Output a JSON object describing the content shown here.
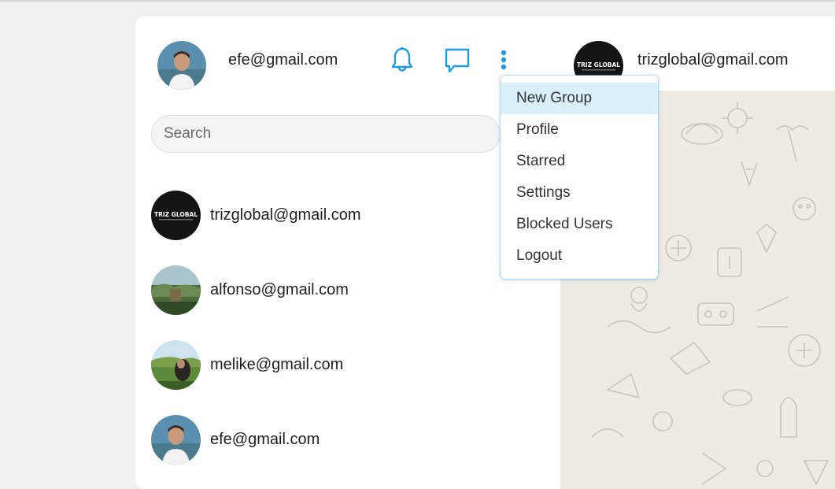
{
  "header": {
    "user_email": "efe@gmail.com"
  },
  "search": {
    "placeholder": "Search"
  },
  "contacts": [
    {
      "email": "trizglobal@gmail.com",
      "avatar": "trizglobal-logo"
    },
    {
      "email": "alfonso@gmail.com",
      "avatar": "landscape-photo"
    },
    {
      "email": "melike@gmail.com",
      "avatar": "person-photo"
    },
    {
      "email": "efe@gmail.com",
      "avatar": "person-photo"
    }
  ],
  "chat": {
    "contact_email": "trizglobal@gmail.com",
    "logo_text": "TRIZ GLOBAL"
  },
  "menu": {
    "items": [
      "New Group",
      "Profile",
      "Starred",
      "Settings",
      "Blocked Users",
      "Logout"
    ],
    "active_index": 0
  },
  "colors": {
    "accent": "#1e9be0",
    "menu_active_bg": "#d9f0fb",
    "chat_bg": "#efeae2"
  }
}
